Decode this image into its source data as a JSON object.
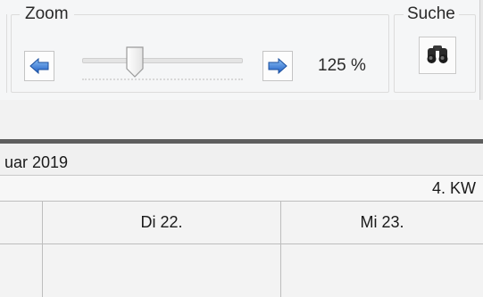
{
  "ribbon": {
    "zoom_group": {
      "title": "Zoom",
      "value_text": "125 %",
      "slider_level_percent": 28,
      "decrease_icon": "arrow-left-icon",
      "increase_icon": "arrow-right-icon"
    },
    "search_group": {
      "title": "Suche",
      "icon": "binoculars-icon"
    }
  },
  "calendar": {
    "month_label": "uar 2019",
    "week_label": "4. KW",
    "days": [
      {
        "label": ""
      },
      {
        "label": "Di 22."
      },
      {
        "label": "Mi 23."
      }
    ]
  },
  "colors": {
    "arrow_blue": "#2f6fd0",
    "arrow_blue_light": "#7fb2f0",
    "ribbon_bg": "#f5f6f7",
    "divider_dark": "#5e5e5e"
  }
}
